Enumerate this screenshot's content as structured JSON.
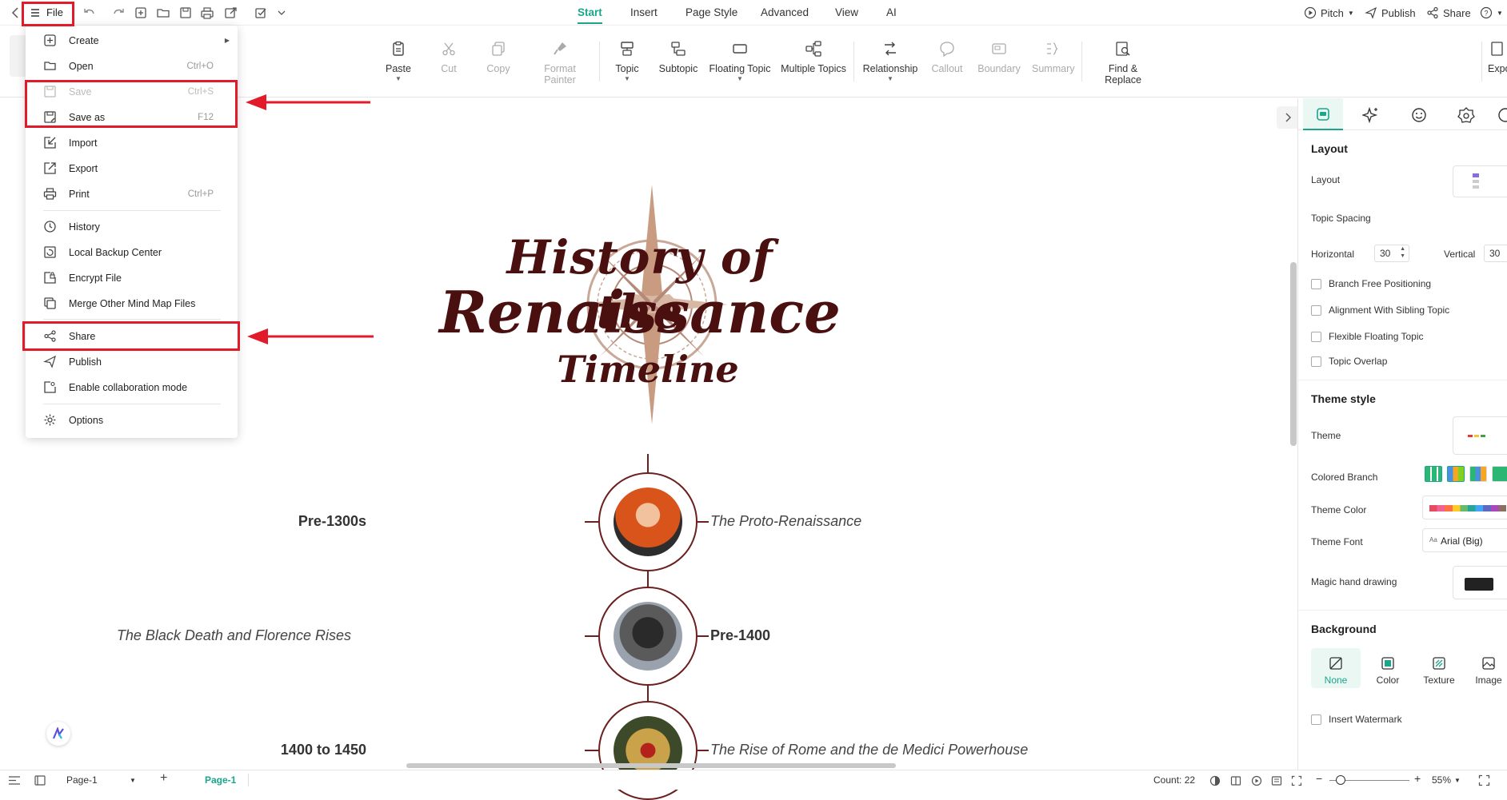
{
  "topbar": {
    "file_label": "File",
    "tabs": [
      "Start",
      "Insert",
      "Page Style",
      "Advanced",
      "View",
      "AI"
    ],
    "right": {
      "pitch": "Pitch",
      "publish": "Publish",
      "share": "Share"
    }
  },
  "ribbon": {
    "paste": "Paste",
    "cut": "Cut",
    "copy": "Copy",
    "format_painter": "Format Painter",
    "topic": "Topic",
    "subtopic": "Subtopic",
    "floating_topic": "Floating Topic",
    "multiple_topics": "Multiple Topics",
    "relationship": "Relationship",
    "callout": "Callout",
    "boundary": "Boundary",
    "summary": "Summary",
    "find_replace": "Find & Replace",
    "export_partial": "Expo"
  },
  "file_menu": {
    "create": "Create",
    "open": "Open",
    "open_sc": "Ctrl+O",
    "save": "Save",
    "save_sc": "Ctrl+S",
    "save_as": "Save as",
    "save_as_sc": "F12",
    "import": "Import",
    "export": "Export",
    "print": "Print",
    "print_sc": "Ctrl+P",
    "history": "History",
    "local_backup": "Local Backup Center",
    "encrypt": "Encrypt File",
    "merge": "Merge Other Mind Map Files",
    "share": "Share",
    "publish": "Publish",
    "collab": "Enable collaboration mode",
    "options": "Options"
  },
  "canvas": {
    "title_line1": "History of the",
    "title_line2": "Renaissance",
    "title_line3": "Timeline",
    "items": [
      {
        "date": "Pre-1300s",
        "label": "The Proto-Renaissance"
      },
      {
        "date": "Pre-1400",
        "label": "The Black Death and Florence Rises"
      },
      {
        "date": "1400 to 1450",
        "label": "The Rise of Rome and the de Medici Powerhouse"
      }
    ]
  },
  "panel": {
    "layout_title": "Layout",
    "layout_label": "Layout",
    "topic_spacing": "Topic Spacing",
    "horizontal": "Horizontal",
    "horizontal_val": "30",
    "vertical": "Vertical",
    "vertical_val": "30",
    "checks": [
      "Branch Free Positioning",
      "Alignment With Sibling Topic",
      "Flexible Floating Topic",
      "Topic Overlap"
    ],
    "theme_style": "Theme style",
    "theme": "Theme",
    "colored_branch": "Colored Branch",
    "theme_color": "Theme Color",
    "theme_font": "Theme Font",
    "theme_font_val": "Arial (Big)",
    "magic": "Magic hand drawing",
    "background": "Background",
    "bg_none": "None",
    "bg_color": "Color",
    "bg_texture": "Texture",
    "bg_image": "Image",
    "watermark": "Insert Watermark"
  },
  "status": {
    "page_tab": "Page-1",
    "page_active": "Page-1",
    "count": "Count: 22",
    "zoom": "55%"
  },
  "colors": {
    "accent": "#1aa68b",
    "highlight": "#e21b2a",
    "timeline": "#6b1f1f"
  }
}
